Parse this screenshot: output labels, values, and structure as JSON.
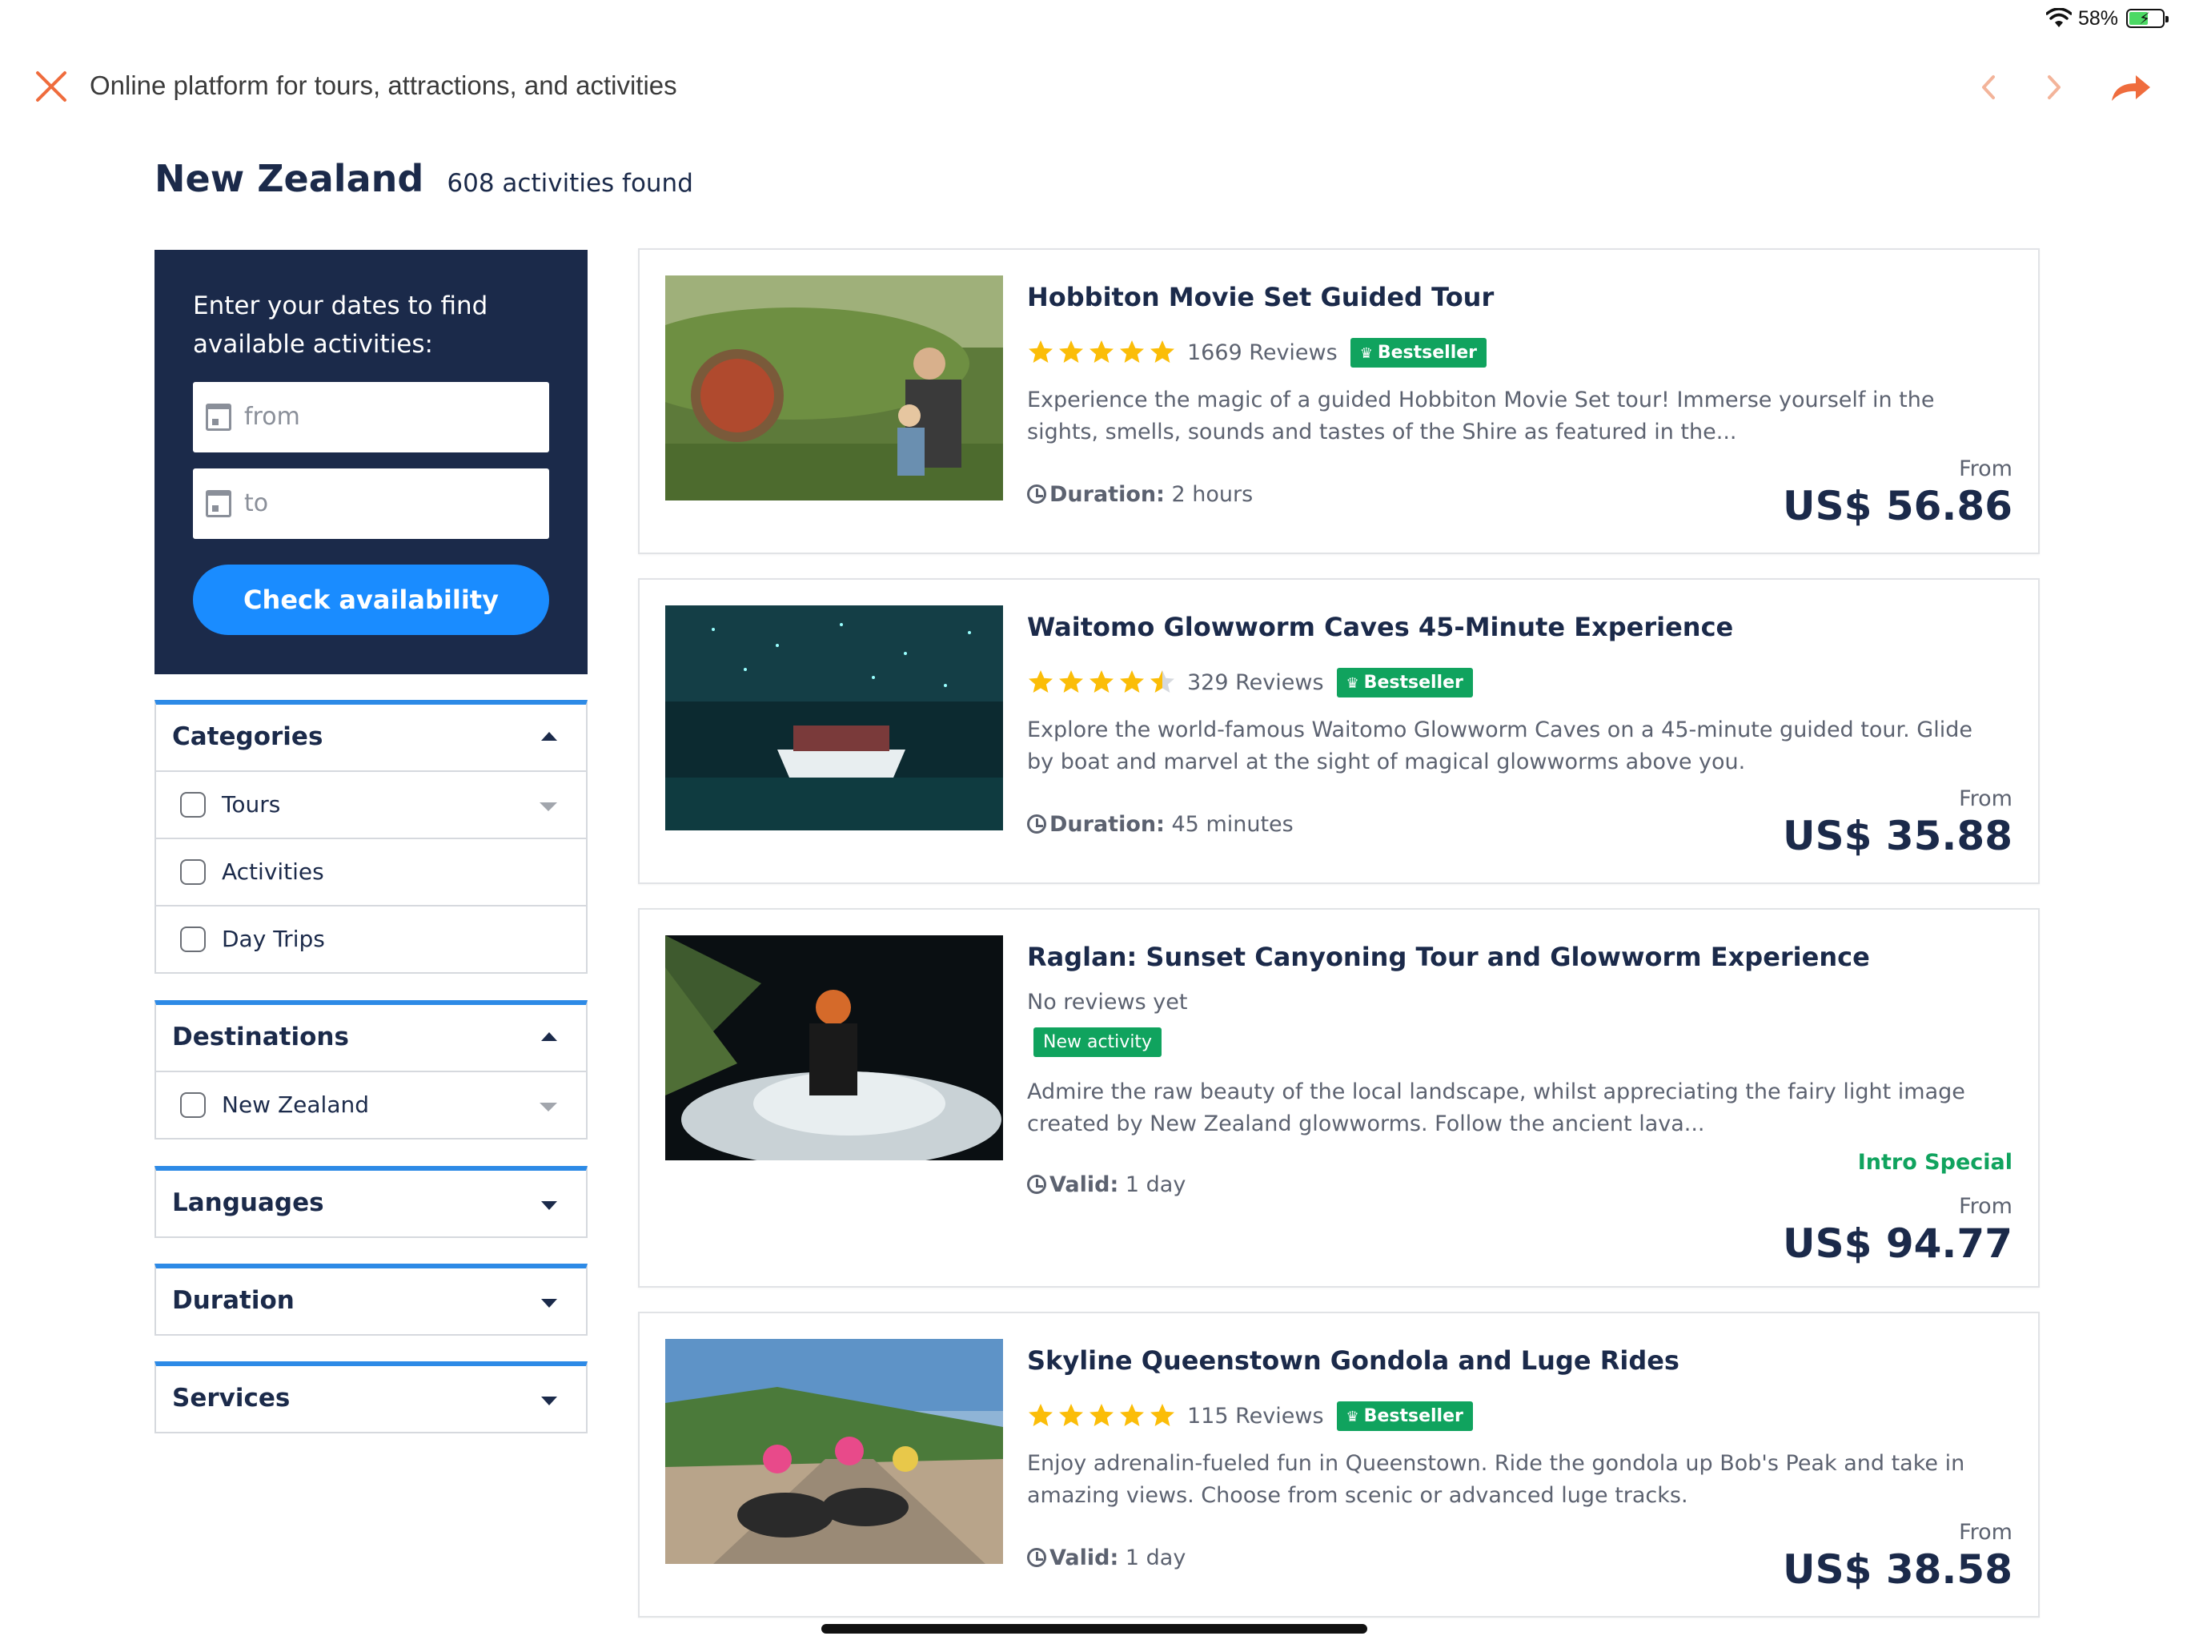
{
  "status_bar": {
    "battery_percent": "58%",
    "battery_level": 0.58
  },
  "nav": {
    "title": "Online platform for tours, attractions, and activities"
  },
  "header": {
    "title": "New Zealand",
    "count": "608 activities found"
  },
  "date_search": {
    "prompt": "Enter your dates to find available activities:",
    "from_placeholder": "from",
    "to_placeholder": "to",
    "button_label": "Check availability"
  },
  "filters": {
    "categories": {
      "title": "Categories",
      "items": [
        "Tours",
        "Activities",
        "Day Trips"
      ]
    },
    "destinations": {
      "title": "Destinations",
      "items": [
        "New Zealand"
      ]
    },
    "languages": {
      "title": "Languages"
    },
    "duration": {
      "title": "Duration"
    },
    "services": {
      "title": "Services"
    }
  },
  "colors": {
    "accent_orange": "#ef6c3d",
    "navy": "#1b2a4a",
    "button_blue": "#1a8cff",
    "filter_border_blue": "#2d8ae6",
    "badge_green": "#10a35e",
    "star_yellow": "#fbbd08"
  },
  "activities": [
    {
      "title": "Hobbiton Movie Set Guided Tour",
      "rating": 5,
      "reviews": "1669 Reviews",
      "badge": "Bestseller",
      "description": "Experience the magic of a guided Hobbiton Movie Set tour! Immerse yourself in the sights, smells, sounds and tastes of the Shire as featured in the...",
      "duration_label": "Duration:",
      "duration_value": "2 hours",
      "from_label": "From",
      "price": "US$ 56.86"
    },
    {
      "title": "Waitomo Glowworm Caves 45-Minute Experience",
      "rating": 4.5,
      "reviews": "329 Reviews",
      "badge": "Bestseller",
      "description": "Explore the world-famous Waitomo Glowworm Caves on a 45-minute guided tour. Glide by boat and marvel at the sight of magical glowworms above you.",
      "duration_label": "Duration:",
      "duration_value": "45 minutes",
      "from_label": "From",
      "price": "US$ 35.88"
    },
    {
      "title": "Raglan: Sunset Canyoning Tour and Glowworm Experience",
      "no_reviews": "No reviews yet",
      "badge": "New activity",
      "description": "Admire the raw beauty of the local landscape, whilst appreciating the fairy light image created by New Zealand glowworms. Follow the ancient lava...",
      "duration_label": "Valid:",
      "duration_value": "1 day",
      "special": "Intro Special",
      "from_label": "From",
      "price": "US$ 94.77"
    },
    {
      "title": "Skyline Queenstown Gondola and Luge Rides",
      "rating": 5,
      "reviews": "115 Reviews",
      "badge": "Bestseller",
      "description": "Enjoy adrenalin-fueled fun in Queenstown. Ride the gondola up Bob's Peak and take in amazing views. Choose from scenic or advanced luge tracks.",
      "duration_label": "Valid:",
      "duration_value": "1 day",
      "from_label": "From",
      "price": "US$ 38.58"
    }
  ]
}
